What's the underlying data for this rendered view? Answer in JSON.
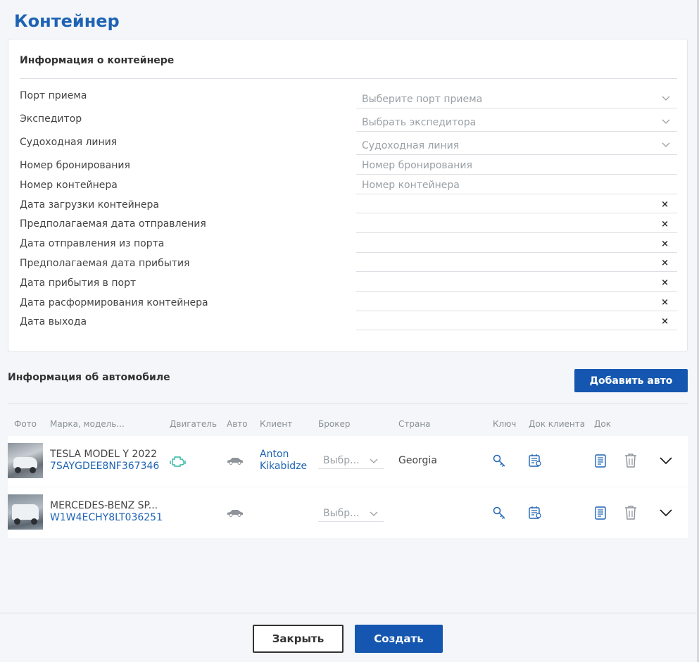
{
  "page": {
    "title": "Контейнер"
  },
  "container_info": {
    "title": "Информация о контейнере",
    "fields": [
      {
        "label": "Порт приема",
        "placeholder": "Выберите порт приема",
        "type": "select"
      },
      {
        "label": "Экспедитор",
        "placeholder": "Выбрать экспедитора",
        "type": "select"
      },
      {
        "label": "Судоходная линия",
        "placeholder": "Судоходная линия",
        "type": "select"
      },
      {
        "label": "Номер бронирования",
        "placeholder": "Номер бронирования",
        "type": "text"
      },
      {
        "label": "Номер контейнера",
        "placeholder": "Номер контейнера",
        "type": "text"
      },
      {
        "label": "Дата загрузки контейнера",
        "placeholder": "",
        "type": "date"
      },
      {
        "label": "Предполагаемая дата отправления",
        "placeholder": "",
        "type": "date"
      },
      {
        "label": "Дата отправления из порта",
        "placeholder": "",
        "type": "date"
      },
      {
        "label": "Предполагаемая дата прибытия",
        "placeholder": "",
        "type": "date"
      },
      {
        "label": "Дата прибытия в порт",
        "placeholder": "",
        "type": "date"
      },
      {
        "label": "Дата расформирования контейнера",
        "placeholder": "",
        "type": "date"
      },
      {
        "label": "Дата выхода",
        "placeholder": "",
        "type": "date"
      }
    ],
    "clear_symbol": "×"
  },
  "vehicle_info": {
    "title": "Информация об автомобиле",
    "add_button_label": "Добавить авто",
    "columns": [
      "Фото",
      "Марка, модель...",
      "Двигатель",
      "Авто",
      "Клиент",
      "Брокер",
      "Страна",
      "Ключ",
      "Док клиента",
      "Док"
    ],
    "rows": [
      {
        "model": "TESLA MODEL Y 2022",
        "vin": "7SAYGDEE8NF367346",
        "has_engine_icon": true,
        "client_line1": "Anton",
        "client_line2": "Kikabidze",
        "broker_placeholder": "Выбр...",
        "country": "Georgia"
      },
      {
        "model": "MERCEDES-BENZ SP...",
        "vin": "W1W4ECHY8LT036251",
        "has_engine_icon": false,
        "client_line1": "",
        "client_line2": "",
        "broker_placeholder": "Выбр...",
        "country": ""
      }
    ]
  },
  "footer": {
    "close_label": "Закрыть",
    "create_label": "Создать"
  },
  "colors": {
    "accent": "#1557b0",
    "link": "#1e63b4",
    "engine_icon": "#2fb8a4"
  },
  "icons": {
    "select_chevron": "chevron-down-icon",
    "engine": "engine-icon",
    "car": "car-icon",
    "key": "key-icon",
    "client_doc": "client-document-icon",
    "doc": "document-icon",
    "delete": "trash-icon",
    "expand": "chevron-down-icon"
  }
}
